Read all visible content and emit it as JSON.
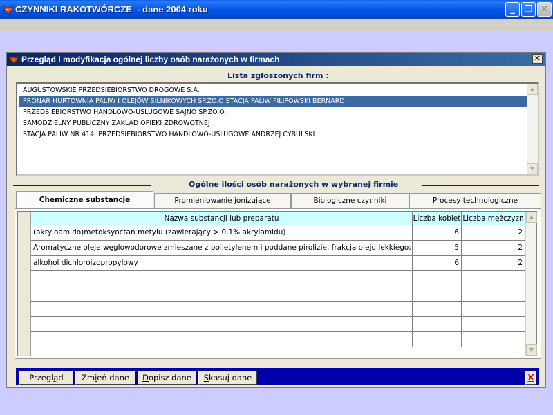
{
  "app": {
    "title": "CZYNNIKI RAKOTWÓRCZE  - dane 2004 roku",
    "window_buttons": {
      "minimize": "_",
      "maximize": "❐",
      "close": "✕"
    }
  },
  "dialog": {
    "title": "Przegląd i modyfikacja ogólnej liczby osób narażonych w firmach",
    "close_label": "✕"
  },
  "firms": {
    "heading": "Lista zgłoszonych firm :",
    "items": [
      "AUGUSTOWSKIE PRZEDSIEBIORSTWO DROGOWE S.A.",
      "PRONAR HURTOWNIA PALIW I OLEJÓW SILNIKOWYCH SP.ZO.O STACJA PALIW FILIPOWSKI BERNARD",
      "PRZEDSIEBIORSTWO HANDLOWO-USLUGOWE SAJNO SP.ZO.O.",
      "SAMODZIELNY PUBLICZNY ZAKLAD OPIEKI ZDROWOTNEJ",
      "STACJA PALIW NR 414. PRZEDSIEBIORSTWO  HANDLOWO-USLUGOWE ANDRZEJ CYBULSKI"
    ],
    "selected_index": 1
  },
  "summary_heading": "Ogólne ilości osób narażonych w wybranej firmie",
  "tabs": [
    {
      "label": "Chemiczne substancje",
      "active": true
    },
    {
      "label": "Promieniowanie jonizujące",
      "active": false
    },
    {
      "label": "Biologiczne czynniki",
      "active": false
    },
    {
      "label": "Procesy technologiczne",
      "active": false
    }
  ],
  "grid": {
    "columns": [
      "Nazwa substancji lub preparatu",
      "Liczba kobiet",
      "Liczba mężczyzn"
    ],
    "rows": [
      {
        "name": "(akryloamido)metoksyoctan metylu (zawierający > 0,1% akrylamidu)",
        "women": "6",
        "men": "2"
      },
      {
        "name": "Aromatyczne oleje węglowodorowe zmieszane z polietylenem i poddane pirolizie, frakcja oleju lekkiego; Produkty",
        "women": "5",
        "men": "2"
      },
      {
        "name": "alkohol dichloroizopropylowy",
        "women": "6",
        "men": "2"
      },
      {
        "name": "",
        "women": "",
        "men": ""
      },
      {
        "name": "",
        "women": "",
        "men": ""
      },
      {
        "name": "",
        "women": "",
        "men": ""
      },
      {
        "name": "",
        "women": "",
        "men": ""
      },
      {
        "name": "",
        "women": "",
        "men": ""
      }
    ]
  },
  "toolbar": {
    "preview": "Przegląd",
    "edit": "Zmień dane",
    "add": "Dopisz dane",
    "delete": "Skasuj dane",
    "exit": "X"
  },
  "icons": {
    "app": "fox-icon",
    "scroll_up": "arrow-up-icon",
    "scroll_down": "arrow-down-icon"
  },
  "colors": {
    "header_cell": "#ccffff",
    "selection": "#3d6aa1",
    "toolbar": "#0000aa",
    "section_label": "#0a246a"
  }
}
